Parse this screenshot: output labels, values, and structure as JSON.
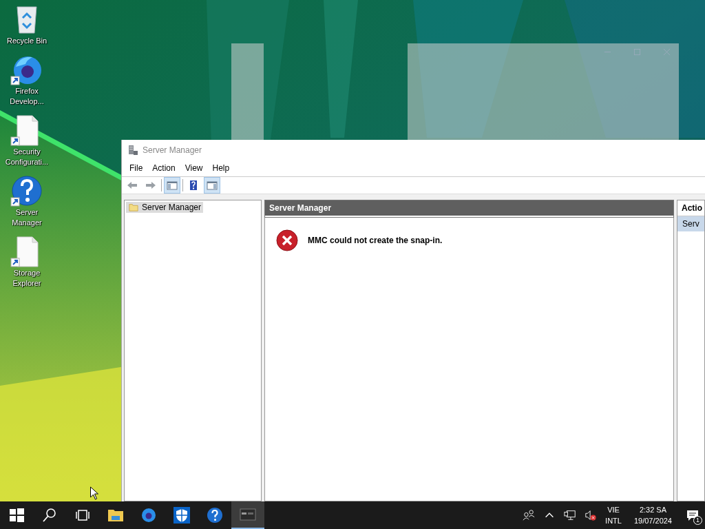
{
  "desktop": {
    "icons": [
      {
        "kind": "recycle",
        "label": "Recycle Bin",
        "shortcut": false
      },
      {
        "kind": "firefox",
        "label": "Firefox Develop...",
        "shortcut": true
      },
      {
        "kind": "document",
        "label": "Security Configurati...",
        "shortcut": true
      },
      {
        "kind": "help",
        "label": "Server Manager",
        "shortcut": true
      },
      {
        "kind": "document",
        "label": "Storage Explorer",
        "shortcut": true
      }
    ]
  },
  "window": {
    "title": "Server Manager",
    "menu": [
      "File",
      "Action",
      "View",
      "Help"
    ],
    "toolbar": [
      {
        "kind": "back",
        "selected": false
      },
      {
        "kind": "forward",
        "selected": false
      },
      {
        "kind": "tree",
        "selected": true
      },
      {
        "kind": "help",
        "selected": false
      },
      {
        "kind": "actions",
        "selected": true
      }
    ],
    "tree": [
      {
        "label": "Server Manager",
        "selected": true
      }
    ],
    "pane": {
      "title": "Server Manager",
      "message": "MMC could not create the snap-in."
    },
    "actions": {
      "title": "Actio",
      "items": [
        {
          "label": "Serv",
          "selected": true
        }
      ]
    }
  },
  "taskbar": {
    "apps": [
      {
        "kind": "start",
        "active": false
      },
      {
        "kind": "search",
        "active": false
      },
      {
        "kind": "taskview",
        "active": false
      },
      {
        "kind": "folder",
        "active": false
      },
      {
        "kind": "firefox",
        "active": false
      },
      {
        "kind": "shield",
        "active": false
      },
      {
        "kind": "help",
        "active": false
      },
      {
        "kind": "console",
        "active": true
      }
    ],
    "tray": {
      "language": "VIE",
      "layout": "INTL",
      "time": "2:32 SA",
      "date": "19/07/2024",
      "notifications": "1"
    }
  }
}
